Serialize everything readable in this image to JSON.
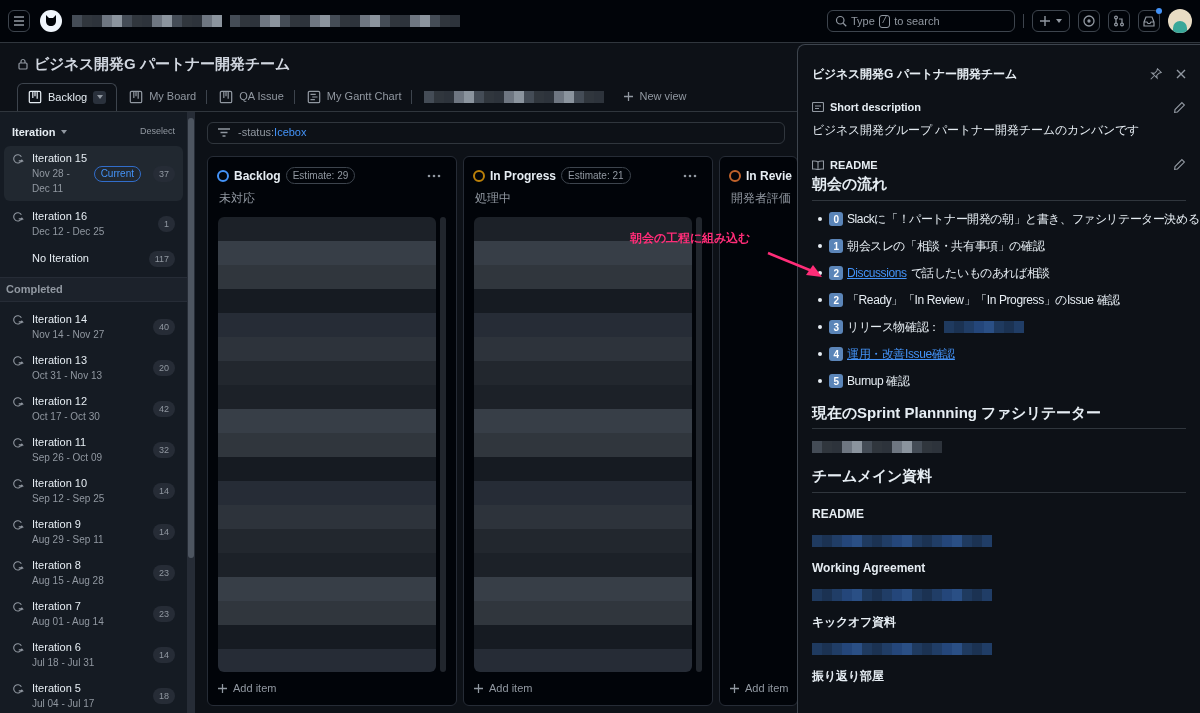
{
  "topbar": {
    "search": {
      "hint_start": "Type",
      "shortcut": "/",
      "hint_end": "to search"
    },
    "inbox_unread": true
  },
  "project": {
    "title": "ビジネス開発G パートナー開発チーム",
    "private": true
  },
  "tabs": [
    {
      "label": "Backlog",
      "selected": true
    },
    {
      "label": "My Board",
      "selected": false
    },
    {
      "label": "QA Issue",
      "selected": false
    },
    {
      "label": "My Gantt Chart",
      "selected": false
    }
  ],
  "new_view": "New view",
  "sidebar": {
    "heading": "Iteration",
    "deselect": "Deselect",
    "items": [
      {
        "kind": "iteration",
        "name": "Iteration 15",
        "dates": "Nov 28 - Dec 11",
        "badge": "Current",
        "count": "37",
        "selected": true
      },
      {
        "kind": "iteration",
        "name": "Iteration 16",
        "dates": "Dec 12 - Dec 25",
        "count": "1",
        "selected": false
      },
      {
        "kind": "none",
        "name": "No Iteration",
        "count": "117",
        "selected": false
      }
    ],
    "completed": {
      "label": "Completed",
      "items": [
        {
          "kind": "iteration",
          "name": "Iteration 14",
          "dates": "Nov 14 - Nov 27",
          "count": "40",
          "selected": false
        },
        {
          "kind": "iteration",
          "name": "Iteration 13",
          "dates": "Oct 31 - Nov 13",
          "count": "20",
          "selected": false
        },
        {
          "kind": "iteration",
          "name": "Iteration 12",
          "dates": "Oct 17 - Oct 30",
          "count": "42",
          "selected": false
        },
        {
          "kind": "iteration",
          "name": "Iteration 11",
          "dates": "Sep 26 - Oct 09",
          "count": "32",
          "selected": false
        },
        {
          "kind": "iteration",
          "name": "Iteration 10",
          "dates": "Sep 12 - Sep 25",
          "count": "14",
          "selected": false
        },
        {
          "kind": "iteration",
          "name": "Iteration 9",
          "dates": "Aug 29 - Sep 11",
          "count": "14",
          "selected": false
        },
        {
          "kind": "iteration",
          "name": "Iteration 8",
          "dates": "Aug 15 - Aug 28",
          "count": "23",
          "selected": false
        },
        {
          "kind": "iteration",
          "name": "Iteration 7",
          "dates": "Aug 01 - Aug 14",
          "count": "23",
          "selected": false
        },
        {
          "kind": "iteration",
          "name": "Iteration 6",
          "dates": "Jul 18 - Jul 31",
          "count": "14",
          "selected": false
        },
        {
          "kind": "iteration",
          "name": "Iteration 5",
          "dates": "Jul 04 - Jul 17",
          "count": "18",
          "selected": false
        }
      ]
    }
  },
  "filter": {
    "prefix": "-status:",
    "value": "Icebox"
  },
  "columns": [
    {
      "title": "Backlog",
      "color": "#4493f8",
      "estimate": "Estimate: 29",
      "subtitle": "未対応",
      "add": "Add item"
    },
    {
      "title": "In Progress",
      "color": "#bb8009",
      "estimate": "Estimate: 21",
      "subtitle": "処理中",
      "add": "Add item"
    },
    {
      "title": "In Revie",
      "color": "#c0622b",
      "subtitle": "開発者評価",
      "add": "Add item"
    }
  ],
  "panel": {
    "title": "ビジネス開発G パートナー開発チーム",
    "short_description": {
      "label": "Short description",
      "text": "ビジネス開発グループ パートナー開発チームのカンバンです"
    },
    "readme": {
      "label": "README",
      "blocks": [
        {
          "kind": "h2",
          "text": "朝会の流れ"
        },
        {
          "kind": "list",
          "items": [
            {
              "key": "0",
              "text": "Slackに「！パートナー開発の朝」と書き、ファシリテーター決める"
            },
            {
              "key": "1",
              "text": "朝会スレの「相談・共有事項」の確認"
            },
            {
              "key": "2",
              "link": "Discussions",
              "text": "で話したいものあれば相談"
            },
            {
              "key": "2",
              "text": "「Ready」「In Review」「In Progress」のIssue 確認"
            },
            {
              "key": "3",
              "text": "リリース物確認：",
              "redacted": true
            },
            {
              "key": "4",
              "link": "運用・改善Issue確認"
            },
            {
              "key": "5",
              "text": "Burnup 確認"
            }
          ]
        },
        {
          "kind": "h2",
          "text": "現在のSprint Plannning ファシリテーター"
        },
        {
          "kind": "redacted"
        },
        {
          "kind": "h2",
          "text": "チームメイン資料"
        },
        {
          "kind": "h3",
          "text": "README"
        },
        {
          "kind": "redacted_link"
        },
        {
          "kind": "h3",
          "text": "Working Agreement"
        },
        {
          "kind": "redacted_link"
        },
        {
          "kind": "h3",
          "text": "キックオフ資料"
        },
        {
          "kind": "redacted_link"
        },
        {
          "kind": "h3",
          "text": "振り返り部屋"
        }
      ]
    }
  },
  "annotation": {
    "text": "朝会の工程に組み込む"
  }
}
